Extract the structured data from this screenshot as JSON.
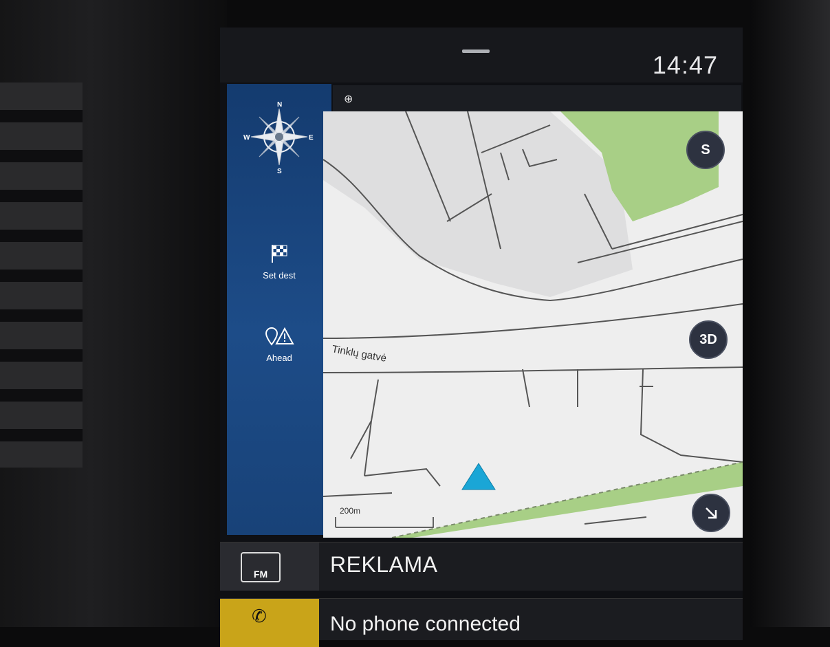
{
  "status": {
    "time": "14:47"
  },
  "sidebar": {
    "compass": {
      "n": "N",
      "e": "E",
      "s": "S",
      "w": "W"
    },
    "set_dest_label": "Set dest",
    "ahead_label": "Ahead"
  },
  "map": {
    "street_label": "Tinklų gatvė",
    "scale_label": "200m",
    "compass_button_label": "S",
    "view_3d_label": "3D"
  },
  "media": {
    "source_label": "FM",
    "station_text": "REKLAMA"
  },
  "phone": {
    "status_text": "No phone connected"
  },
  "colors": {
    "sidebar": "#1d4c88",
    "map_bg": "#eeeeee",
    "park": "#a8cf86",
    "position_arrow": "#1aa6d6",
    "phone_accent": "#c9a419"
  }
}
